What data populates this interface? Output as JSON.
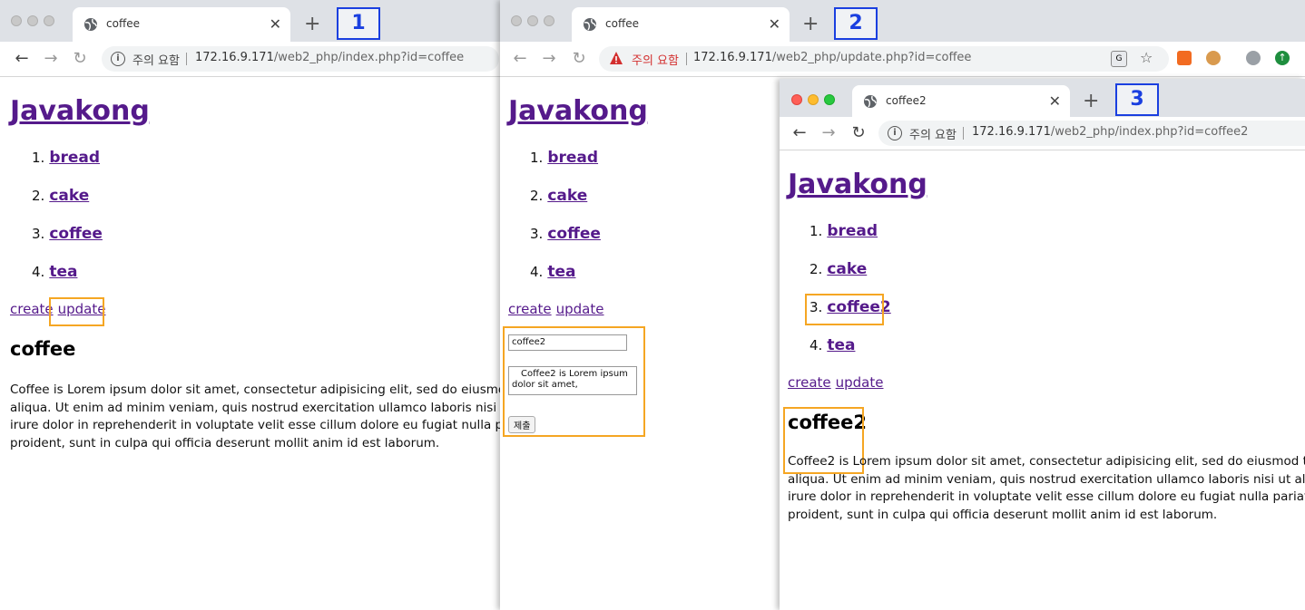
{
  "colors": {
    "link": "#551a8b",
    "highlight": "#f5a623",
    "badge": "#1a3fe0",
    "warning": "#d32f2f"
  },
  "windows": [
    {
      "badge": "1",
      "tab_title": "coffee",
      "security_label": "주의 요함",
      "url_host": "172.16.9.171",
      "url_path": "/web2_php/index.php?id=coffee",
      "site_title": "Javakong",
      "nav": [
        {
          "num": "1.",
          "label": "bread"
        },
        {
          "num": "2.",
          "label": "cake"
        },
        {
          "num": "3.",
          "label": "coffee"
        },
        {
          "num": "4.",
          "label": "tea"
        }
      ],
      "create_label": "create",
      "update_label": "update",
      "heading": "coffee",
      "body_lines": [
        "Coffee is Lorem ipsum dolor sit amet, consectetur adipisicing elit, sed do eiusmod",
        "aliqua. Ut enim ad minim veniam, quis nostrud exercitation ullamco laboris nisi ut",
        "irure dolor in reprehenderit in voluptate velit esse cillum dolore eu fugiat nulla pa",
        "proident, sunt in culpa qui officia deserunt mollit anim id est laborum."
      ]
    },
    {
      "badge": "2",
      "tab_title": "coffee",
      "security_label": "주의 요함",
      "url_host": "172.16.9.171",
      "url_path": "/web2_php/update.php?id=coffee",
      "site_title": "Javakong",
      "nav": [
        {
          "num": "1.",
          "label": "bread"
        },
        {
          "num": "2.",
          "label": "cake"
        },
        {
          "num": "3.",
          "label": "coffee"
        },
        {
          "num": "4.",
          "label": "tea"
        }
      ],
      "create_label": "create",
      "update_label": "update",
      "form": {
        "title_value": "coffee2",
        "description_line1": "Coffee2 is Lorem ipsum",
        "description_line2": "dolor sit amet,",
        "submit_label": "제출"
      }
    },
    {
      "badge": "3",
      "tab_title": "coffee2",
      "security_label": "주의 요함",
      "url_host": "172.16.9.171",
      "url_path": "/web2_php/index.php?id=coffee2",
      "site_title": "Javakong",
      "nav": [
        {
          "num": "1.",
          "label": "bread"
        },
        {
          "num": "2.",
          "label": "cake"
        },
        {
          "num": "3.",
          "label": "coffee2"
        },
        {
          "num": "4.",
          "label": "tea"
        }
      ],
      "create_label": "create",
      "update_label": "update",
      "heading": "coffee2",
      "body_lines": [
        "Coffee2 is Lorem ipsum dolor sit amet, consectetur adipisicing elit, sed do eiusmod te",
        "aliqua. Ut enim ad minim veniam, quis nostrud exercitation ullamco laboris nisi ut aliq",
        "irure dolor in reprehenderit in voluptate velit esse cillum dolore eu fugiat nulla pariatu",
        "proident, sunt in culpa qui officia deserunt mollit anim id est laborum."
      ]
    }
  ]
}
